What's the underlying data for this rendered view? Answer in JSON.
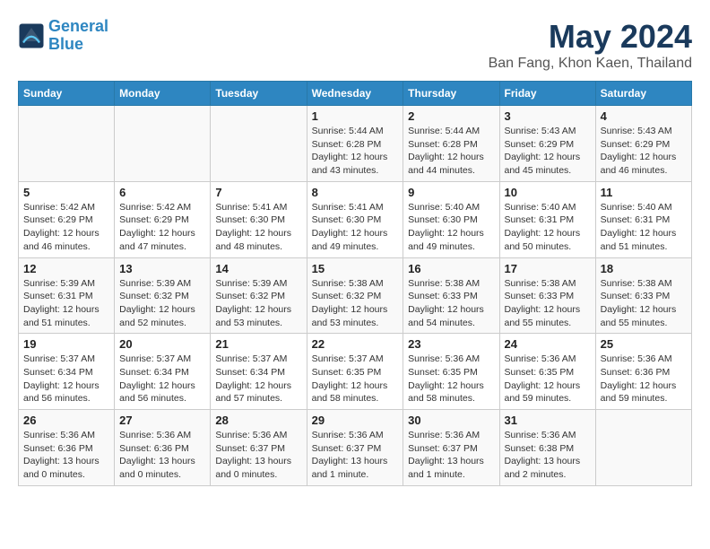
{
  "header": {
    "logo_line1": "General",
    "logo_line2": "Blue",
    "title": "May 2024",
    "subtitle": "Ban Fang, Khon Kaen, Thailand"
  },
  "weekdays": [
    "Sunday",
    "Monday",
    "Tuesday",
    "Wednesday",
    "Thursday",
    "Friday",
    "Saturday"
  ],
  "weeks": [
    [
      {
        "day": "",
        "info": ""
      },
      {
        "day": "",
        "info": ""
      },
      {
        "day": "",
        "info": ""
      },
      {
        "day": "1",
        "info": "Sunrise: 5:44 AM\nSunset: 6:28 PM\nDaylight: 12 hours\nand 43 minutes."
      },
      {
        "day": "2",
        "info": "Sunrise: 5:44 AM\nSunset: 6:28 PM\nDaylight: 12 hours\nand 44 minutes."
      },
      {
        "day": "3",
        "info": "Sunrise: 5:43 AM\nSunset: 6:29 PM\nDaylight: 12 hours\nand 45 minutes."
      },
      {
        "day": "4",
        "info": "Sunrise: 5:43 AM\nSunset: 6:29 PM\nDaylight: 12 hours\nand 46 minutes."
      }
    ],
    [
      {
        "day": "5",
        "info": "Sunrise: 5:42 AM\nSunset: 6:29 PM\nDaylight: 12 hours\nand 46 minutes."
      },
      {
        "day": "6",
        "info": "Sunrise: 5:42 AM\nSunset: 6:29 PM\nDaylight: 12 hours\nand 47 minutes."
      },
      {
        "day": "7",
        "info": "Sunrise: 5:41 AM\nSunset: 6:30 PM\nDaylight: 12 hours\nand 48 minutes."
      },
      {
        "day": "8",
        "info": "Sunrise: 5:41 AM\nSunset: 6:30 PM\nDaylight: 12 hours\nand 49 minutes."
      },
      {
        "day": "9",
        "info": "Sunrise: 5:40 AM\nSunset: 6:30 PM\nDaylight: 12 hours\nand 49 minutes."
      },
      {
        "day": "10",
        "info": "Sunrise: 5:40 AM\nSunset: 6:31 PM\nDaylight: 12 hours\nand 50 minutes."
      },
      {
        "day": "11",
        "info": "Sunrise: 5:40 AM\nSunset: 6:31 PM\nDaylight: 12 hours\nand 51 minutes."
      }
    ],
    [
      {
        "day": "12",
        "info": "Sunrise: 5:39 AM\nSunset: 6:31 PM\nDaylight: 12 hours\nand 51 minutes."
      },
      {
        "day": "13",
        "info": "Sunrise: 5:39 AM\nSunset: 6:32 PM\nDaylight: 12 hours\nand 52 minutes."
      },
      {
        "day": "14",
        "info": "Sunrise: 5:39 AM\nSunset: 6:32 PM\nDaylight: 12 hours\nand 53 minutes."
      },
      {
        "day": "15",
        "info": "Sunrise: 5:38 AM\nSunset: 6:32 PM\nDaylight: 12 hours\nand 53 minutes."
      },
      {
        "day": "16",
        "info": "Sunrise: 5:38 AM\nSunset: 6:33 PM\nDaylight: 12 hours\nand 54 minutes."
      },
      {
        "day": "17",
        "info": "Sunrise: 5:38 AM\nSunset: 6:33 PM\nDaylight: 12 hours\nand 55 minutes."
      },
      {
        "day": "18",
        "info": "Sunrise: 5:38 AM\nSunset: 6:33 PM\nDaylight: 12 hours\nand 55 minutes."
      }
    ],
    [
      {
        "day": "19",
        "info": "Sunrise: 5:37 AM\nSunset: 6:34 PM\nDaylight: 12 hours\nand 56 minutes."
      },
      {
        "day": "20",
        "info": "Sunrise: 5:37 AM\nSunset: 6:34 PM\nDaylight: 12 hours\nand 56 minutes."
      },
      {
        "day": "21",
        "info": "Sunrise: 5:37 AM\nSunset: 6:34 PM\nDaylight: 12 hours\nand 57 minutes."
      },
      {
        "day": "22",
        "info": "Sunrise: 5:37 AM\nSunset: 6:35 PM\nDaylight: 12 hours\nand 58 minutes."
      },
      {
        "day": "23",
        "info": "Sunrise: 5:36 AM\nSunset: 6:35 PM\nDaylight: 12 hours\nand 58 minutes."
      },
      {
        "day": "24",
        "info": "Sunrise: 5:36 AM\nSunset: 6:35 PM\nDaylight: 12 hours\nand 59 minutes."
      },
      {
        "day": "25",
        "info": "Sunrise: 5:36 AM\nSunset: 6:36 PM\nDaylight: 12 hours\nand 59 minutes."
      }
    ],
    [
      {
        "day": "26",
        "info": "Sunrise: 5:36 AM\nSunset: 6:36 PM\nDaylight: 13 hours\nand 0 minutes."
      },
      {
        "day": "27",
        "info": "Sunrise: 5:36 AM\nSunset: 6:36 PM\nDaylight: 13 hours\nand 0 minutes."
      },
      {
        "day": "28",
        "info": "Sunrise: 5:36 AM\nSunset: 6:37 PM\nDaylight: 13 hours\nand 0 minutes."
      },
      {
        "day": "29",
        "info": "Sunrise: 5:36 AM\nSunset: 6:37 PM\nDaylight: 13 hours\nand 1 minute."
      },
      {
        "day": "30",
        "info": "Sunrise: 5:36 AM\nSunset: 6:37 PM\nDaylight: 13 hours\nand 1 minute."
      },
      {
        "day": "31",
        "info": "Sunrise: 5:36 AM\nSunset: 6:38 PM\nDaylight: 13 hours\nand 2 minutes."
      },
      {
        "day": "",
        "info": ""
      }
    ]
  ]
}
